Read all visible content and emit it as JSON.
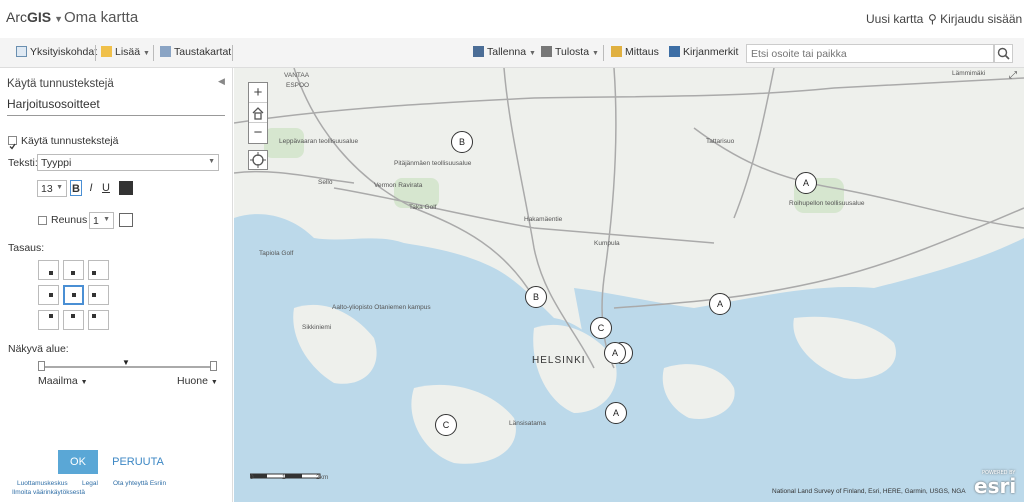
{
  "app": {
    "brand_prefix": "Arc",
    "brand_bold": "GIS",
    "map_title": "Oma kartta"
  },
  "header": {
    "new_map": "Uusi kartta",
    "sign_in": "Kirjaudu sisään"
  },
  "toolbar": {
    "details": "Yksityiskohdat",
    "add": "Lisää",
    "basemap": "Taustakartat",
    "save": "Tallenna",
    "print": "Tulosta",
    "measure": "Mittaus",
    "bookmarks": "Kirjanmerkit",
    "search_placeholder": "Etsi osoite tai paikka"
  },
  "panel": {
    "title": "Käytä tunnustekstejä",
    "layer": "Harjoitusosoitteet",
    "enable_label": "Käytä tunnustekstejä",
    "text_label": "Teksti:",
    "text_field": "Tyyppi",
    "font_size": "13",
    "bold": "B",
    "italic": "I",
    "underline": "U",
    "text_color": "#333333",
    "halo_label": "Reunus",
    "halo_size": "1",
    "halo_color": "#ffffff",
    "align_label": "Tasaus:",
    "visible_label": "Näkyvä alue:",
    "range_min": "Maailma",
    "range_max": "Huone",
    "ok": "OK",
    "cancel": "PERUUTA"
  },
  "footer": {
    "trust": "Luottamuskeskus",
    "legal": "Legal",
    "contact": "Ota yhteyttä Esriin",
    "report": "Ilmoita väärinkäytöksestä"
  },
  "map": {
    "city": "HELSINKI",
    "places": [
      "VANTAA",
      "ESPOO",
      "Leppävaaran teollisuusalue",
      "Pitäjänmäen teollisuusalue",
      "Vermon Ravirata",
      "Sello",
      "Taka Golf",
      "Tapiola Golf",
      "Aalto-yliopisto Otaniemen kampus",
      "Sikkiniemi",
      "Kumpula",
      "Hakamäentie",
      "Tattarisuo",
      "Länsisatama",
      "Roihupellon teollisuusalue",
      "Lämmimäki"
    ],
    "markers": [
      {
        "label": "B"
      },
      {
        "label": "A"
      },
      {
        "label": "B"
      },
      {
        "label": "A"
      },
      {
        "label": "C"
      },
      {
        "label": "C"
      },
      {
        "label": "A"
      },
      {
        "label": "A"
      },
      {
        "label": "C"
      }
    ],
    "scale_labels": [
      "0",
      "1",
      "2km"
    ],
    "attribution": "National Land Survey of Finland, Esri, HERE, Garmin, USGS, NGA",
    "powered_by": "POWERED BY",
    "esri": "esri"
  },
  "colors": {
    "water": "#bcd9ea",
    "land": "#eef0ec",
    "park": "#d6e6cf",
    "accent": "#5aa7d6"
  }
}
